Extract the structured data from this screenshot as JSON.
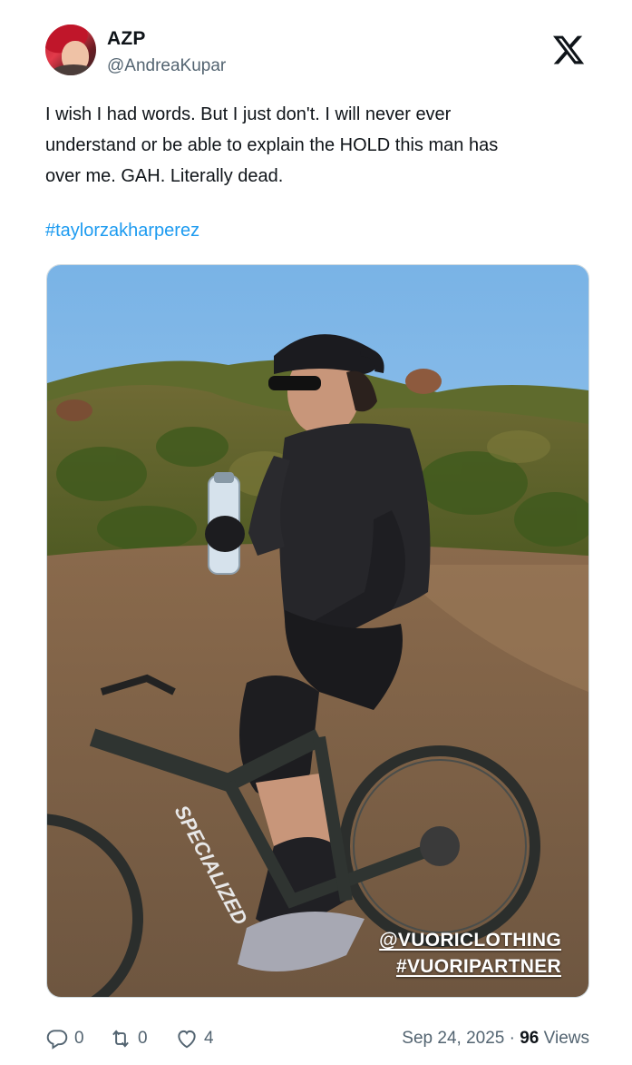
{
  "author": {
    "display_name": "AZP",
    "handle": "@AndreaKupar",
    "avatar_icon": "profile-photo"
  },
  "platform_logo": "x-logo",
  "tweet": {
    "text": "I wish I had words. But I just don't. I will never ever\nunderstand or be able to explain the HOLD this man has\nover me. GAH. Literally dead.",
    "hashtag": "#taylorzakharperez"
  },
  "media": {
    "description_icon": "photo-man-on-mountain-bike",
    "overlay_line1": "@VUORICLOTHING",
    "overlay_line2": "#VUORIPARTNER"
  },
  "actions": {
    "reply_count": "0",
    "retweet_count": "0",
    "like_count": "4"
  },
  "meta": {
    "date": "Sep 24, 2025",
    "separator": " · ",
    "views_count": "96",
    "views_label": " Views"
  },
  "colors": {
    "link": "#1d9bf0",
    "secondary_text": "#536471",
    "primary_text": "#0f1419"
  }
}
